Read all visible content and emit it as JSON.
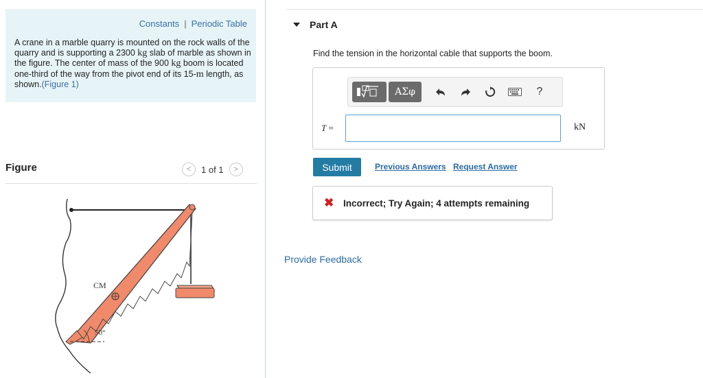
{
  "left_panel": {
    "links": {
      "constants": "Constants",
      "separator": "|",
      "periodic_table": "Periodic Table"
    },
    "problem": {
      "part1": "A crane in a marble quarry is mounted on the rock walls of the quarry and is supporting a 2300 ",
      "unit_kg": "kg",
      "part2": " slab of marble as shown in the figure. The center of mass of the 900 ",
      "part3": " boom is located one-third of the way from the pivot end of its 15-",
      "unit_m": "m",
      "part4": " length, as shown.",
      "figure_link": "(Figure 1)"
    },
    "figure": {
      "label": "Figure",
      "pager_text": "1 of 1",
      "prev_glyph": "<",
      "next_glyph": ">",
      "cm_label": "CM",
      "angle_label": "50°"
    }
  },
  "right_panel": {
    "part_title": "Part A",
    "question": "Find the tension in the horizontal cable that supports the boom.",
    "toolbar": {
      "templates_icon": "sqrt-template-icon",
      "greek_label": "ΑΣφ",
      "undo_icon": "undo-icon",
      "redo_icon": "redo-icon",
      "reset_icon": "reset-icon",
      "keyboard_icon": "keyboard-icon",
      "help_label": "?"
    },
    "answer": {
      "variable": "T",
      "equals": " =",
      "value": "",
      "unit": "kN"
    },
    "submit_label": "Submit",
    "previous_answers": "Previous Answers",
    "request_answer": "Request Answer",
    "feedback": {
      "icon": "x-icon",
      "message": "Incorrect; Try Again; 4 attempts remaining"
    },
    "provide_feedback": "Provide Feedback"
  },
  "colors": {
    "intro_bg": "#e7f4f7",
    "link": "#2a6aa3",
    "submit_bg": "#247ba3",
    "error": "#d02020",
    "boom_fill": "#f08a6a",
    "input_border": "#5a9fd6"
  }
}
